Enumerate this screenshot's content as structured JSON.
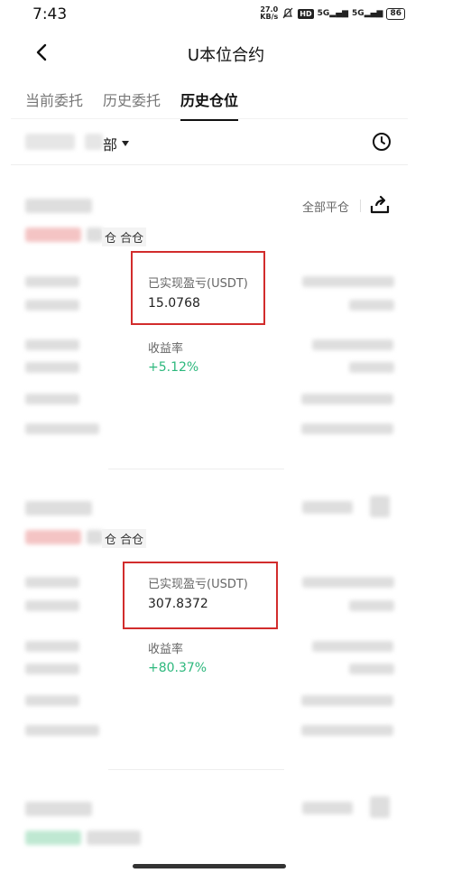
{
  "status_bar": {
    "time": "7:43",
    "net_speed_value": "27.0",
    "net_speed_unit": "KB/s",
    "hd_label": "HD",
    "signal_1": "5G",
    "signal_2": "5G",
    "battery": "86"
  },
  "header": {
    "title": "U本位合约"
  },
  "tabs": [
    {
      "label": "当前委托",
      "active": false
    },
    {
      "label": "历史委托",
      "active": false
    },
    {
      "label": "历史仓位",
      "active": true
    }
  ],
  "filter": {
    "partial_label": "部"
  },
  "cards": [
    {
      "close_all_label": "全部平仓",
      "tag_text": "仓 合仓",
      "pnl_label": "已实现盈亏(USDT)",
      "pnl_value": "15.0768",
      "yield_label": "收益率",
      "yield_value": "+5.12%"
    },
    {
      "tag_text": "仓 合仓",
      "pnl_label": "已实现盈亏(USDT)",
      "pnl_value": "307.8372",
      "yield_label": "收益率",
      "yield_value": "+80.37%"
    }
  ],
  "colors": {
    "highlight_border": "#d22c2c",
    "positive": "#2db87d",
    "text_primary": "#222222",
    "text_secondary": "#666666"
  },
  "icons": {
    "back": "chevron-left-icon",
    "history": "clock-icon",
    "share": "share-icon",
    "filter_caret": "caret-down-icon"
  }
}
